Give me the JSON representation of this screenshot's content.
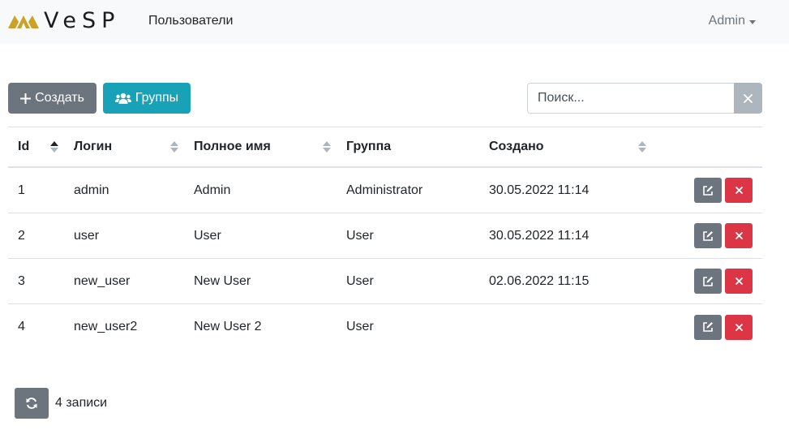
{
  "brand": {
    "logo_text": "VeSP",
    "accent": "#c9a227"
  },
  "nav": {
    "users_label": "Пользователи",
    "user_menu": "Admin"
  },
  "toolbar": {
    "create_label": "Создать",
    "groups_label": "Группы",
    "search_placeholder": "Поиск...",
    "search_value": ""
  },
  "table": {
    "columns": [
      "Id",
      "Логин",
      "Полное имя",
      "Группа",
      "Создано"
    ],
    "sort": {
      "column": "Id",
      "direction": "asc"
    },
    "rows": [
      {
        "id": "1",
        "login": "admin",
        "name": "Admin",
        "group": "Administrator",
        "created": "30.05.2022 11:14"
      },
      {
        "id": "2",
        "login": "user",
        "name": "User",
        "group": "User",
        "created": "30.05.2022 11:14"
      },
      {
        "id": "3",
        "login": "new_user",
        "name": "New User",
        "group": "User",
        "created": "02.06.2022 11:15"
      },
      {
        "id": "4",
        "login": "new_user2",
        "name": "New User 2",
        "group": "User",
        "created": ""
      }
    ]
  },
  "footer": {
    "count_label": "4 записи"
  },
  "icons": {
    "create": "plus-icon",
    "groups": "users-icon",
    "clear": "close-icon",
    "edit": "edit-icon",
    "delete": "close-icon",
    "refresh": "refresh-icon"
  },
  "colors": {
    "secondary": "#6c757d",
    "info": "#17a2b8",
    "danger": "#dc3545",
    "muted": "#adb5bd"
  }
}
